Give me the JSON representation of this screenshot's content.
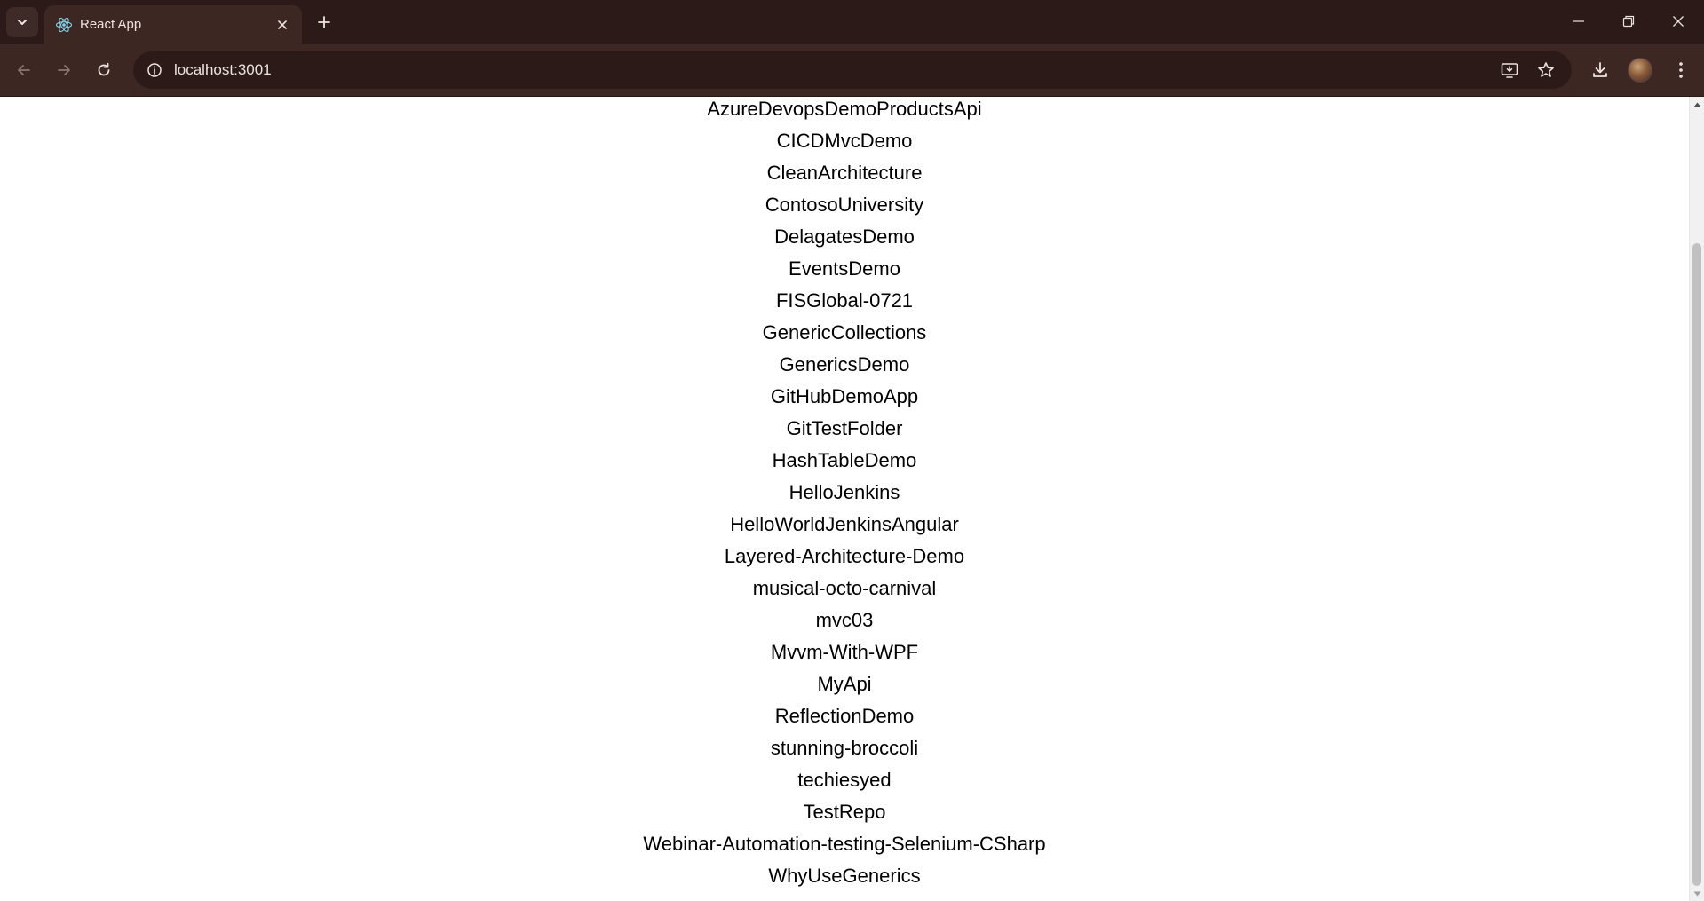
{
  "browser": {
    "tab": {
      "title": "React App",
      "favicon": "react-icon"
    },
    "address_bar": {
      "url": "localhost:3001"
    },
    "icons": {
      "tab_search": "chevron-down-icon",
      "tab_close": "close-icon",
      "new_tab": "plus-icon",
      "minimize": "minimize-icon",
      "maximize": "restore-icon",
      "window_close": "close-icon",
      "back": "arrow-left-icon",
      "forward": "arrow-right-icon",
      "reload": "reload-icon",
      "site_info": "info-icon",
      "install": "install-app-icon",
      "bookmark": "star-icon",
      "downloads": "download-icon",
      "profile": "avatar",
      "menu": "kebab-menu-icon"
    },
    "colors": {
      "tabstrip_bg": "#2b1a17",
      "toolbar_bg": "#3d2723",
      "text": "#ece3e1"
    }
  },
  "page": {
    "repos": [
      "AzureDevopsDemoProductsApi",
      "CICDMvcDemo",
      "CleanArchitecture",
      "ContosoUniversity",
      "DelagatesDemo",
      "EventsDemo",
      "FISGlobal-0721",
      "GenericCollections",
      "GenericsDemo",
      "GitHubDemoApp",
      "GitTestFolder",
      "HashTableDemo",
      "HelloJenkins",
      "HelloWorldJenkinsAngular",
      "Layered-Architecture-Demo",
      "musical-octo-carnival",
      "mvc03",
      "Mvvm-With-WPF",
      "MyApi",
      "ReflectionDemo",
      "stunning-broccoli",
      "techiesyed",
      "TestRepo",
      "Webinar-Automation-testing-Selenium-CSharp",
      "WhyUseGenerics"
    ]
  }
}
